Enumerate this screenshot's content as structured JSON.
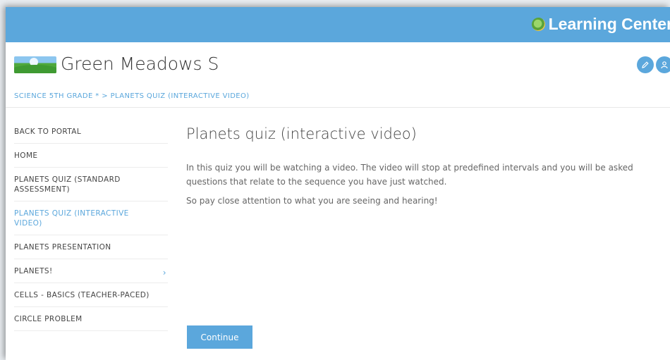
{
  "app": {
    "brand_name": "Learning Center",
    "school_name": "Green Meadows S"
  },
  "breadcrumb": "SCIENCE 5TH GRADE * > PLANETS QUIZ (INTERACTIVE VIDEO)",
  "sidebar": {
    "items": [
      {
        "label": "BACK TO PORTAL"
      },
      {
        "label": "HOME"
      },
      {
        "label": "PLANETS QUIZ (STANDARD ASSESSMENT)"
      },
      {
        "label": "PLANETS QUIZ (INTERACTIVE VIDEO)",
        "active": true
      },
      {
        "label": "PLANETS PRESENTATION"
      },
      {
        "label": "PLANETS!",
        "icon": "chevron-right-icon"
      },
      {
        "label": "CELLS - BASICS (TEACHER-PACED)"
      },
      {
        "label": "CIRCLE PROBLEM"
      }
    ]
  },
  "main": {
    "title": "Planets quiz (interactive video)",
    "paragraphs": [
      "In this quiz you will be watching a video. The video will stop at predefined intervals and you will be asked questions that relate to the sequence you have just watched.",
      "So pay close attention to what you are seeing and hearing!"
    ],
    "continue_label": "Continue"
  },
  "header_icons": [
    "edit-icon",
    "user-icon"
  ],
  "colors": {
    "accent": "#5ba7dc",
    "text": "#444444",
    "muted": "#666666"
  }
}
